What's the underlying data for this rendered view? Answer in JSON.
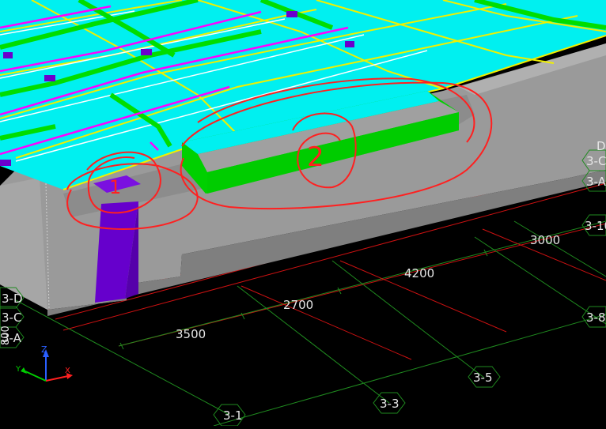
{
  "viewport": {
    "background": "#000000",
    "colors": {
      "slab": "#00ffff",
      "beam_green": "#00e600",
      "beam_yellow": "#f0f000",
      "beam_magenta": "#ff00ff",
      "concrete": "#999999",
      "column": "#6600cc",
      "grid_red": "#cc1111",
      "grid_green": "#1f8a1f",
      "annotation": "#ff2020",
      "label_text": "#e6e6e6"
    },
    "dimensions": {
      "d3500": "3500",
      "d2700": "2700",
      "d4200": "4200",
      "d3000": "3000"
    },
    "axis_labels": {
      "a_3_1": "3-1",
      "a_3_3": "3-3",
      "a_3_5": "3-5",
      "a_3_8": "3-8",
      "a_3_10": "3-10",
      "a_3_A_right": "3-A",
      "a_3_C_right": "3-C",
      "a_3_D_right": "D",
      "a_3_D_left": "3-D",
      "a_3_C_left": "3-C",
      "a_3_A_left": "3-A",
      "edge_left": "800"
    },
    "annotations": {
      "circle_1_text": "1",
      "circle_2_text": "2"
    },
    "triad": {
      "z": "Z",
      "x": "X",
      "y": "Y"
    }
  }
}
